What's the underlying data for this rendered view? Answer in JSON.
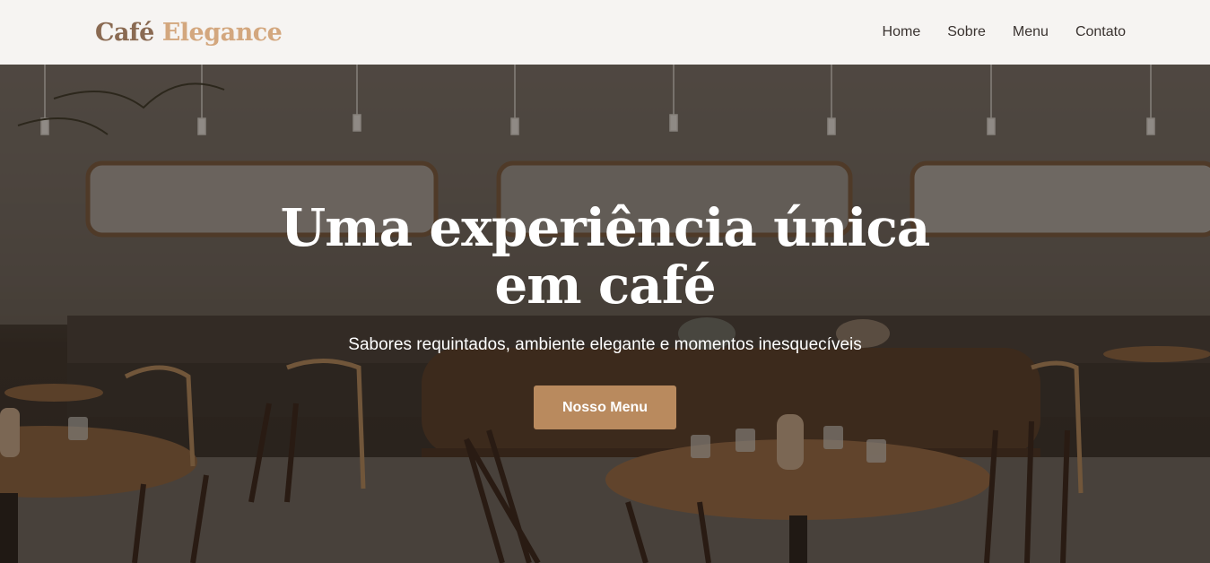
{
  "brand": {
    "word1": "Café",
    "word2": "Elegance"
  },
  "nav": {
    "items": [
      "Home",
      "Sobre",
      "Menu",
      "Contato"
    ]
  },
  "hero": {
    "title": "Uma experiência única em café",
    "subtitle": "Sabores requintados, ambiente elegante e momentos inesquecíveis",
    "cta_label": "Nosso Menu"
  },
  "colors": {
    "brand_dark": "#8a6a52",
    "brand_light": "#d3a77e",
    "accent": "#b98a5e",
    "nav_bg": "#f6f4f2"
  }
}
